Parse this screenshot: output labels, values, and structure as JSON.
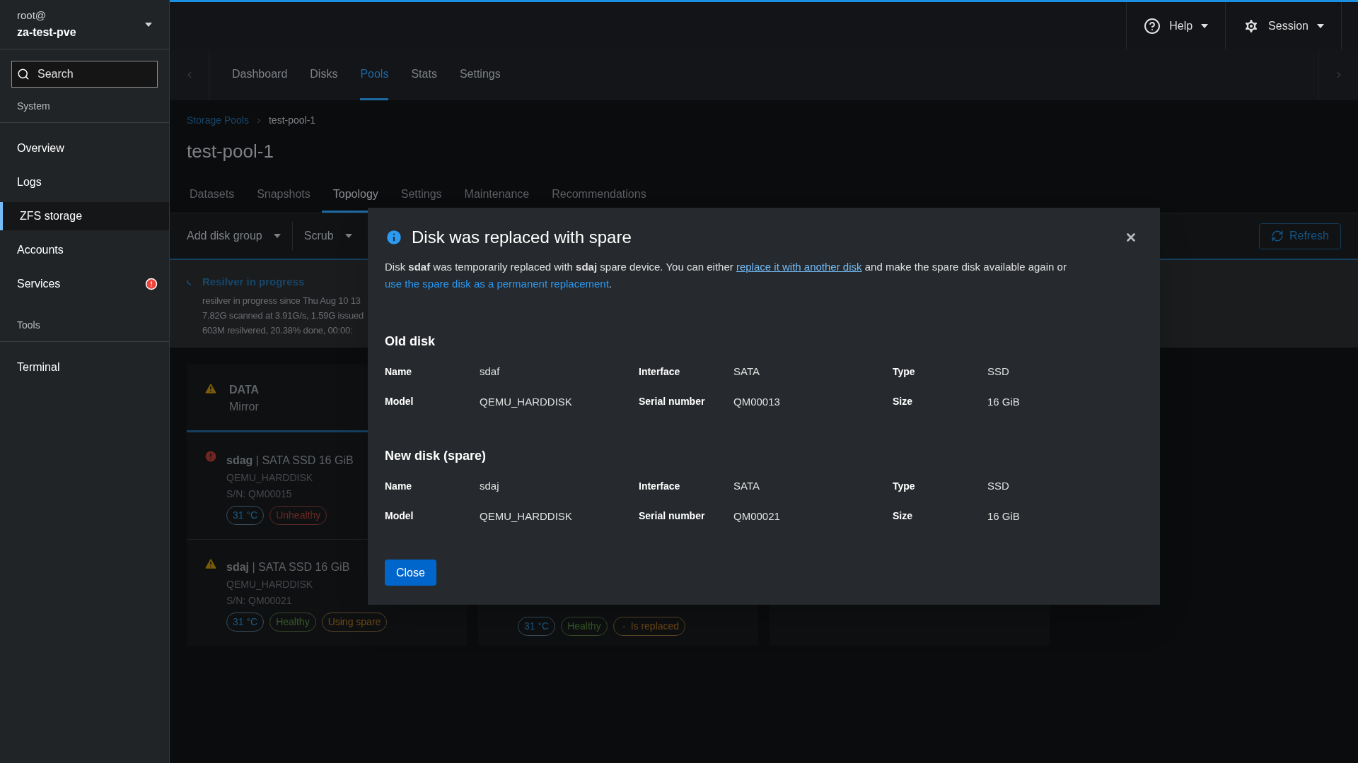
{
  "sidebar": {
    "user": "root@",
    "host": "za-test-pve",
    "search": {
      "placeholder": "Search"
    },
    "sections": [
      {
        "title": "System",
        "items": [
          {
            "label": "Overview",
            "selected": false,
            "alert": false
          },
          {
            "label": "Logs",
            "selected": false,
            "alert": false
          },
          {
            "label": "ZFS storage",
            "selected": true,
            "alert": false
          },
          {
            "label": "Accounts",
            "selected": false,
            "alert": false
          },
          {
            "label": "Services",
            "selected": false,
            "alert": true
          }
        ]
      },
      {
        "title": "Tools",
        "items": [
          {
            "label": "Terminal",
            "selected": false,
            "alert": false
          }
        ]
      }
    ]
  },
  "header": {
    "menus": [
      {
        "label": "Help",
        "kind": "help"
      },
      {
        "label": "Session",
        "kind": "session"
      }
    ]
  },
  "nav": {
    "tabs": [
      {
        "label": "Dashboard",
        "selected": false
      },
      {
        "label": "Disks",
        "selected": false
      },
      {
        "label": "Pools",
        "selected": true
      },
      {
        "label": "Stats",
        "selected": false
      },
      {
        "label": "Settings",
        "selected": false
      }
    ]
  },
  "breadcrumb": {
    "link": "Storage Pools",
    "current": "test-pool-1"
  },
  "title": "test-pool-1",
  "pool_tabs": [
    {
      "label": "Datasets",
      "selected": false
    },
    {
      "label": "Snapshots",
      "selected": false
    },
    {
      "label": "Topology",
      "selected": true
    },
    {
      "label": "Settings",
      "selected": false
    },
    {
      "label": "Maintenance",
      "selected": false
    },
    {
      "label": "Recommendations",
      "selected": false
    }
  ],
  "toolbar": {
    "dropdowns": [
      "Add disk group",
      "Scrub"
    ],
    "refresh": "Refresh"
  },
  "alert": {
    "title": "Resilver in progress",
    "lines": [
      "resilver in progress since Thu Aug 10 13",
      "7.82G scanned at 3.91G/s, 1.59G issued",
      "603M resilvered, 20.38% done, 00:00:"
    ]
  },
  "cards": [
    {
      "kind": "group",
      "group": {
        "name": "DATA",
        "type": "Mirror",
        "kind": "warning"
      },
      "disks": [
        {
          "name": "sdag",
          "desc": " | SATA SSD 16 GiB",
          "model": "QEMU_HARDDISK",
          "serial": "S/N: QM00015",
          "kind": "error",
          "badges": [
            {
              "label": "31 °C",
              "kind": "temp"
            },
            {
              "label": "Unhealthy",
              "kind": "bad"
            }
          ]
        },
        {
          "name": "sdaj",
          "desc": " | SATA SSD 16 GiB",
          "model": "QEMU_HARDDISK",
          "serial": "S/N: QM00021",
          "kind": "warning",
          "badges": [
            {
              "label": "31 °C",
              "kind": "temp"
            },
            {
              "label": "Healthy",
              "kind": "good"
            },
            {
              "label": "Using spare",
              "kind": "spare"
            }
          ]
        }
      ]
    },
    {
      "kind": "partial",
      "disks": [
        {
          "badges": [
            {
              "label": "31 °C",
              "kind": "temp"
            },
            {
              "label": "Healthy",
              "kind": "good"
            },
            {
              "label": "Is replaced",
              "kind": "replaced"
            }
          ]
        }
      ]
    },
    {
      "kind": "blank"
    }
  ],
  "modal": {
    "title": "Disk was replaced with spare",
    "message": [
      {
        "kind": "text",
        "text": "Disk **sdaf** was temporarily replaced with **sdaj** spare device. You can either "
      },
      {
        "kind": "link",
        "text": "replace it with another disk",
        "underlined": true
      },
      {
        "kind": "text",
        "text": " and make the spare disk available again or "
      },
      {
        "kind": "link",
        "text": "use the spare disk as a permanent replacement",
        "underlined": false
      },
      {
        "kind": "text",
        "text": "."
      }
    ],
    "sections": [
      {
        "title": "Old disk",
        "fields": [
          {
            "label": "Name",
            "value": "sdaf"
          },
          {
            "label": "Interface",
            "value": "SATA"
          },
          {
            "label": "Type",
            "value": "SSD"
          },
          {
            "label": "Model",
            "value": "QEMU_HARDDISK"
          },
          {
            "label": "Serial number",
            "value": "QM00013"
          },
          {
            "label": "Size",
            "value": "16 GiB"
          }
        ]
      },
      {
        "title": "New disk (spare)",
        "fields": [
          {
            "label": "Name",
            "value": "sdaj"
          },
          {
            "label": "Interface",
            "value": "SATA"
          },
          {
            "label": "Type",
            "value": "SSD"
          },
          {
            "label": "Model",
            "value": "QEMU_HARDDISK"
          },
          {
            "label": "Serial number",
            "value": "QM00021"
          },
          {
            "label": "Size",
            "value": "16 GiB"
          }
        ]
      }
    ],
    "button": "Close"
  }
}
